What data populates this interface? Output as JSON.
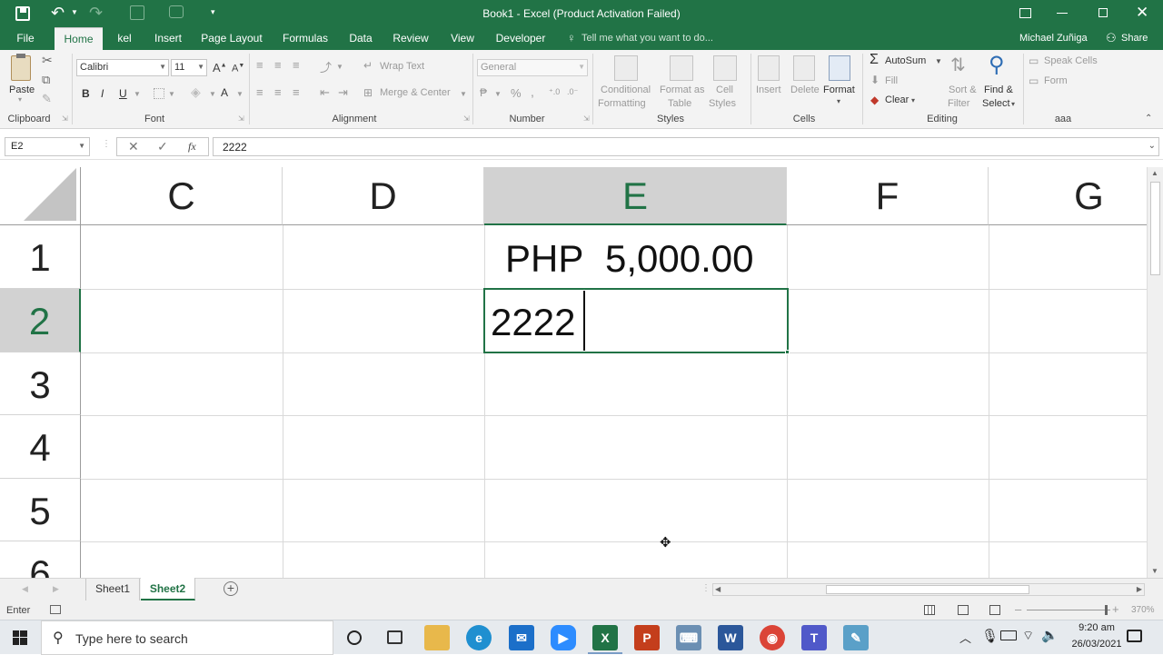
{
  "window": {
    "title": "Book1 - Excel (Product Activation Failed)"
  },
  "tabs": [
    "File",
    "Home",
    "kel",
    "Insert",
    "Page Layout",
    "Formulas",
    "Data",
    "Review",
    "View",
    "Developer"
  ],
  "tell_me": "Tell me what you want to do...",
  "user": "Michael Zuñiga",
  "share": "Share",
  "ribbon": {
    "clipboard": {
      "paste": "Paste",
      "label": "Clipboard"
    },
    "font": {
      "name": "Calibri",
      "size": "11",
      "bold": "B",
      "italic": "I",
      "underline": "U",
      "label": "Font"
    },
    "alignment": {
      "wrap": "Wrap Text",
      "merge": "Merge & Center",
      "label": "Alignment"
    },
    "number": {
      "format": "General",
      "percent": "%",
      "comma": ",",
      "label": "Number"
    },
    "styles": {
      "cond1": "Conditional",
      "cond2": "Formatting",
      "fmt1": "Format as",
      "fmt2": "Table",
      "cell1": "Cell",
      "cell2": "Styles",
      "label": "Styles"
    },
    "cells": {
      "insert": "Insert",
      "delete": "Delete",
      "format": "Format",
      "label": "Cells"
    },
    "editing": {
      "autosum": "AutoSum",
      "fill": "Fill",
      "clear": "Clear",
      "sort1": "Sort &",
      "sort2": "Filter",
      "find1": "Find &",
      "find2": "Select",
      "label": "Editing"
    },
    "aaa": {
      "speak": "Speak Cells",
      "form": "Form",
      "label": "aaa"
    }
  },
  "formula_bar": {
    "name_box": "E2",
    "fx": "fx",
    "value": "2222"
  },
  "columns": [
    "C",
    "D",
    "E",
    "F",
    "G"
  ],
  "selected_column": "E",
  "rows": [
    "1",
    "2",
    "3",
    "4",
    "5",
    "6"
  ],
  "selected_row": "2",
  "cells": {
    "E1_currency": "PHP",
    "E1_amount": "5,000.00",
    "E2": "2222"
  },
  "sheets": [
    "Sheet1",
    "Sheet2"
  ],
  "active_sheet": "Sheet2",
  "status": {
    "mode": "Enter",
    "zoom": "370%"
  },
  "taskbar": {
    "search_placeholder": "Type here to search",
    "time": "9:20 am",
    "date": "26/03/2021"
  },
  "colors": {
    "excel_green": "#217346",
    "selection_header": "#d2d2d2"
  }
}
